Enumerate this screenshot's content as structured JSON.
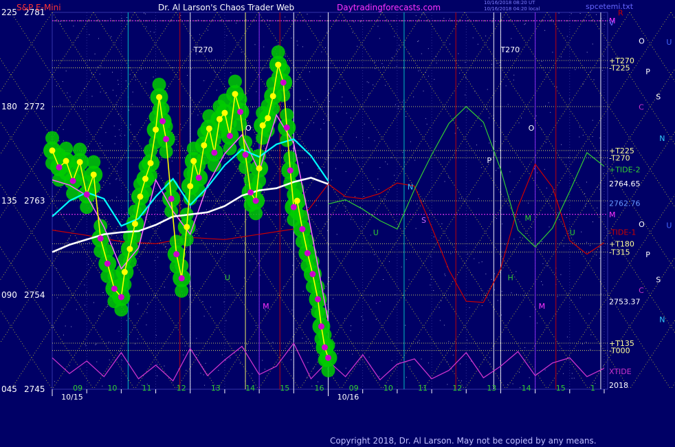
{
  "header": {
    "instrument": "S&P E-Mini",
    "title": "Dr. Al Larson's Chaos Trader Web",
    "site": "Daytradingforecasts.com",
    "stamp_line1": "10/16/2018 08:20 UT",
    "stamp_line2": "10/16/2018 04:20 local",
    "file": "spcetemi.txt"
  },
  "copyright": "Copyright 2018, Dr. Al Larson. May not be copied by any means.",
  "colors": {
    "background": "#000066",
    "price_candle_halo": "#00cc00",
    "price_high_dot": "#ffff00",
    "price_low_dot": "#cc00cc",
    "price_line": "#ffff00",
    "ma_fast": "#ff66ff",
    "ma_mid": "#00ffff",
    "ma_slow": "#ffffff",
    "tide1": "#cc0000",
    "tide2": "#33cc33",
    "xtide": "#cc33cc"
  },
  "chart_data": {
    "type": "line",
    "title": "S&P E-Mini",
    "xlabel": "",
    "ylabel": "",
    "ylim": [
      2745,
      2781
    ],
    "left_axis_labels": [
      {
        "angle": "225",
        "price": "2781",
        "value": 2781
      },
      {
        "angle": "180",
        "price": "2772",
        "value": 2772
      },
      {
        "angle": "135",
        "price": "2763",
        "value": 2763
      },
      {
        "angle": "090",
        "price": "2754",
        "value": 2754
      },
      {
        "angle": "045",
        "price": "2745",
        "value": 2745
      }
    ],
    "hour_ticks": [
      {
        "label": "09",
        "hour": 9.0
      },
      {
        "label": "10",
        "hour": 10.0
      },
      {
        "label": "11",
        "hour": 11.0
      },
      {
        "label": "12",
        "hour": 12.0
      },
      {
        "label": "13",
        "hour": 13.0
      },
      {
        "label": "14",
        "hour": 14.0
      },
      {
        "label": "15",
        "hour": 15.0
      },
      {
        "label": "16",
        "hour": 16.0
      },
      {
        "label": "09",
        "hour": 17.0
      },
      {
        "label": "10",
        "hour": 18.0
      },
      {
        "label": "11",
        "hour": 19.0
      },
      {
        "label": "12",
        "hour": 20.0
      },
      {
        "label": "13",
        "hour": 21.0
      },
      {
        "label": "14",
        "hour": 22.0
      },
      {
        "label": "15",
        "hour": 23.0
      },
      {
        "label": "1",
        "hour": 24.0
      }
    ],
    "date_labels": [
      {
        "label": "10/15",
        "hour": 8.5
      },
      {
        "label": "10/16",
        "hour": 16.5
      }
    ],
    "right_labels": [
      {
        "label": "M",
        "value": 2780.2,
        "color": "#ff33ff"
      },
      {
        "label": "V",
        "value": 2780.0,
        "color": "#6666ff"
      },
      {
        "label": "+T270",
        "value": 2776.4,
        "color": "#ffff99"
      },
      {
        "label": "-T225",
        "value": 2775.7,
        "color": "#ffff99"
      },
      {
        "label": "+T225",
        "value": 2767.8,
        "color": "#ffff99"
      },
      {
        "label": "-T270",
        "value": 2767.1,
        "color": "#ffff99"
      },
      {
        "label": "+TIDE-2",
        "value": 2766.0,
        "color": "#33cc33"
      },
      {
        "label": "2764.65",
        "value": 2764.65,
        "color": "#ffffff"
      },
      {
        "label": "2762.76",
        "value": 2762.76,
        "color": "#6699ff"
      },
      {
        "label": "M",
        "value": 2761.7,
        "color": "#ff33ff"
      },
      {
        "label": "-TIDE-1",
        "value": 2760.0,
        "color": "#cc0000"
      },
      {
        "label": "+T180",
        "value": 2758.9,
        "color": "#ffff99"
      },
      {
        "label": "-T315",
        "value": 2758.1,
        "color": "#ffff99"
      },
      {
        "label": "2753.37",
        "value": 2753.37,
        "color": "#ffffff"
      },
      {
        "label": "+T135",
        "value": 2749.4,
        "color": "#ffff99"
      },
      {
        "label": "-T000",
        "value": 2748.7,
        "color": "#ffff99"
      },
      {
        "label": "XTIDE",
        "value": 2746.7,
        "color": "#cc33cc"
      },
      {
        "label": "2018",
        "value": 2745.4,
        "color": "#ffffff"
      }
    ],
    "planet_letters": [
      {
        "label": "R",
        "hour": 24.4,
        "value": 2780.7,
        "color": "#cc0000"
      },
      {
        "label": "O",
        "hour": 25.0,
        "value": 2778.0,
        "color": "#ffffff"
      },
      {
        "label": "U",
        "hour": 25.8,
        "value": 2777.9,
        "color": "#4466ff"
      },
      {
        "label": "P",
        "hour": 25.2,
        "value": 2775.1,
        "color": "#ffffff"
      },
      {
        "label": "S",
        "hour": 25.5,
        "value": 2772.7,
        "color": "#ffffff"
      },
      {
        "label": "C",
        "hour": 25.0,
        "value": 2771.7,
        "color": "#cc33cc"
      },
      {
        "label": "N",
        "hour": 25.6,
        "value": 2768.7,
        "color": "#33ccff"
      },
      {
        "label": "O",
        "hour": 25.0,
        "value": 2760.5,
        "color": "#ffffff"
      },
      {
        "label": "U",
        "hour": 25.8,
        "value": 2760.4,
        "color": "#4466ff"
      },
      {
        "label": "P",
        "hour": 25.2,
        "value": 2757.6,
        "color": "#ffffff"
      },
      {
        "label": "S",
        "hour": 25.5,
        "value": 2755.2,
        "color": "#ffffff"
      },
      {
        "label": "C",
        "hour": 25.0,
        "value": 2754.2,
        "color": "#cc33cc"
      },
      {
        "label": "N",
        "hour": 25.6,
        "value": 2751.4,
        "color": "#33ccff"
      }
    ],
    "chart_annotations": [
      {
        "label": "T270",
        "hour": 12.1,
        "value": 2777.2,
        "color": "#ffffff"
      },
      {
        "label": "T270",
        "hour": 21.0,
        "value": 2777.2,
        "color": "#ffffff"
      },
      {
        "label": "O",
        "hour": 13.6,
        "value": 2769.7,
        "color": "#ffffff"
      },
      {
        "label": "N",
        "hour": 18.3,
        "value": 2764.1,
        "color": "#33ccff"
      },
      {
        "label": "S",
        "hour": 18.7,
        "value": 2760.9,
        "color": "#cc66ff"
      },
      {
        "label": "P",
        "hour": 20.6,
        "value": 2766.6,
        "color": "#ffffff"
      },
      {
        "label": "O",
        "hour": 21.8,
        "value": 2769.7,
        "color": "#ffffff"
      },
      {
        "label": "M",
        "hour": 14.1,
        "value": 2752.7,
        "color": "#ff33ff"
      },
      {
        "label": "M",
        "hour": 22.1,
        "value": 2752.7,
        "color": "#ff33ff"
      },
      {
        "label": "H",
        "hour": 21.2,
        "value": 2755.4,
        "color": "#33cc33"
      },
      {
        "label": "U",
        "hour": 13.0,
        "value": 2755.4,
        "color": "#33cc33"
      },
      {
        "label": "U",
        "hour": 17.3,
        "value": 2759.7,
        "color": "#33cc33"
      },
      {
        "label": "M",
        "hour": 21.7,
        "value": 2761.1,
        "color": "#33cc33"
      },
      {
        "label": "U",
        "hour": 23.0,
        "value": 2759.7,
        "color": "#33cc33"
      }
    ],
    "series": [
      {
        "name": "price",
        "x": [
          8.0,
          8.2,
          8.4,
          8.6,
          8.8,
          9.0,
          9.2,
          9.4,
          9.6,
          9.8,
          10.0,
          10.1,
          10.25,
          10.4,
          10.55,
          10.7,
          10.85,
          11.0,
          11.1,
          11.2,
          11.3,
          11.45,
          11.6,
          11.75,
          11.9,
          12.0,
          12.1,
          12.25,
          12.4,
          12.55,
          12.7,
          12.85,
          13.0,
          13.15,
          13.3,
          13.45,
          13.6,
          13.75,
          13.9,
          14.0,
          14.1,
          14.25,
          14.4,
          14.55,
          14.7,
          14.8,
          14.9,
          15.0,
          15.1,
          15.25,
          15.4,
          15.55,
          15.7,
          15.8,
          15.9,
          16.0
        ],
        "values": [
          2767.8,
          2766.2,
          2766.8,
          2764.9,
          2766.7,
          2763.6,
          2765.5,
          2759.4,
          2757.0,
          2754.6,
          2753.8,
          2756.2,
          2758.4,
          2760.8,
          2763.4,
          2765.1,
          2766.6,
          2769.8,
          2772.9,
          2770.6,
          2768.9,
          2763.2,
          2757.9,
          2755.6,
          2760.5,
          2764.4,
          2766.8,
          2765.2,
          2768.3,
          2769.9,
          2767.6,
          2770.8,
          2771.4,
          2769.2,
          2773.2,
          2771.5,
          2767.4,
          2763.8,
          2763.0,
          2766.1,
          2770.2,
          2770.9,
          2773.0,
          2776.0,
          2774.3,
          2770.0,
          2765.9,
          2762.4,
          2763.0,
          2760.3,
          2758.0,
          2756.0,
          2753.6,
          2751.0,
          2749.0,
          2748.0
        ]
      },
      {
        "name": "ma_fast",
        "x": [
          8.0,
          8.5,
          9.0,
          9.5,
          10.0,
          10.5,
          11.0,
          11.5,
          12.0,
          12.5,
          13.0,
          13.5,
          14.0,
          14.5,
          15.0,
          15.5,
          16.0
        ],
        "values": [
          2765.0,
          2764.5,
          2763.5,
          2760.5,
          2756.5,
          2758.5,
          2765.0,
          2762.0,
          2759.8,
          2764.5,
          2767.5,
          2769.3,
          2765.8,
          2771.2,
          2768.5,
          2760.3,
          2751.5
        ]
      },
      {
        "name": "ma_mid",
        "x": [
          8.0,
          8.5,
          9.0,
          9.5,
          10.0,
          10.5,
          11.0,
          11.5,
          12.0,
          12.5,
          13.0,
          13.5,
          14.0,
          14.5,
          15.0,
          15.5,
          16.0
        ],
        "values": [
          2761.5,
          2763.0,
          2763.8,
          2763.2,
          2760.6,
          2761.3,
          2763.4,
          2765.1,
          2762.6,
          2764.3,
          2766.4,
          2767.9,
          2767.2,
          2768.4,
          2768.9,
          2767.3,
          2764.9
        ]
      },
      {
        "name": "ma_slow",
        "x": [
          8.0,
          8.5,
          9.0,
          9.5,
          10.0,
          10.5,
          11.0,
          11.5,
          12.0,
          12.5,
          13.0,
          13.5,
          14.0,
          14.5,
          15.0,
          15.5,
          16.0
        ],
        "values": [
          2758.1,
          2758.8,
          2759.3,
          2759.8,
          2760.0,
          2760.1,
          2760.7,
          2761.5,
          2761.7,
          2761.9,
          2762.5,
          2763.5,
          2764.0,
          2764.2,
          2764.8,
          2765.2,
          2764.6
        ]
      },
      {
        "name": "TIDE-1",
        "x": [
          8.0,
          9.0,
          10.0,
          11.0,
          12.0,
          13.0,
          14.0,
          15.0,
          16.0,
          16.5,
          17.0,
          17.5,
          18.0,
          18.5,
          19.0,
          19.5,
          20.0,
          20.5,
          21.0,
          21.5,
          22.0,
          22.5,
          23.0,
          23.5,
          24.0
        ],
        "values": [
          2760.2,
          2759.7,
          2759.1,
          2758.9,
          2759.5,
          2759.3,
          2759.8,
          2760.3,
          2764.6,
          2763.4,
          2763.2,
          2763.7,
          2764.7,
          2764.4,
          2760.5,
          2756.4,
          2753.4,
          2753.3,
          2756.5,
          2762.4,
          2766.5,
          2764.3,
          2759.2,
          2757.9,
          2759.0
        ]
      },
      {
        "name": "TIDE-2",
        "x": [
          16.0,
          16.5,
          17.0,
          17.5,
          18.0,
          18.5,
          19.0,
          19.5,
          20.0,
          20.5,
          21.0,
          21.5,
          22.0,
          22.5,
          23.0,
          23.5,
          24.0
        ],
        "values": [
          2762.7,
          2763.1,
          2762.2,
          2761.1,
          2760.3,
          2764.1,
          2767.4,
          2770.4,
          2772.0,
          2770.5,
          2766.0,
          2760.2,
          2758.6,
          2760.4,
          2763.9,
          2767.6,
          2766.3
        ]
      },
      {
        "name": "XTIDE",
        "x": [
          8.0,
          8.5,
          9.0,
          9.5,
          10.0,
          10.5,
          11.0,
          11.5,
          12.0,
          12.5,
          13.0,
          13.5,
          14.0,
          14.5,
          15.0,
          15.5,
          16.0,
          16.5,
          17.0,
          17.5,
          18.0,
          18.5,
          19.0,
          19.5,
          20.0,
          20.5,
          21.0,
          21.5,
          22.0,
          22.5,
          23.0,
          23.5,
          24.0
        ],
        "values": [
          2748.0,
          2746.5,
          2747.7,
          2746.2,
          2748.5,
          2746.0,
          2747.3,
          2745.8,
          2748.9,
          2746.3,
          2747.8,
          2749.1,
          2746.4,
          2747.2,
          2749.4,
          2746.0,
          2747.7,
          2746.2,
          2748.3,
          2745.9,
          2747.4,
          2747.9,
          2746.0,
          2746.8,
          2748.5,
          2746.1,
          2747.2,
          2748.6,
          2746.3,
          2747.5,
          2748.0,
          2746.2,
          2747.0
        ]
      }
    ],
    "vertical_markers": [
      {
        "hour": 10.2,
        "color": "#00cccc"
      },
      {
        "hour": 11.7,
        "color": "#cc0000"
      },
      {
        "hour": 12.0,
        "color": "#ffffff"
      },
      {
        "hour": 13.6,
        "color": "#ffff66"
      },
      {
        "hour": 14.0,
        "color": "#9933ff"
      },
      {
        "hour": 14.6,
        "color": "#cc0000"
      },
      {
        "hour": 15.0,
        "color": "#ffffff"
      },
      {
        "hour": 16.0,
        "color": "#ffffff"
      },
      {
        "hour": 18.2,
        "color": "#00cccc"
      },
      {
        "hour": 19.7,
        "color": "#cc0000"
      },
      {
        "hour": 20.8,
        "color": "#ffffff"
      },
      {
        "hour": 21.0,
        "color": "#ffffff"
      },
      {
        "hour": 22.0,
        "color": "#9933ff"
      },
      {
        "hour": 22.6,
        "color": "#cc0000"
      },
      {
        "hour": 23.9,
        "color": "#ffffff"
      }
    ],
    "grid": true
  }
}
